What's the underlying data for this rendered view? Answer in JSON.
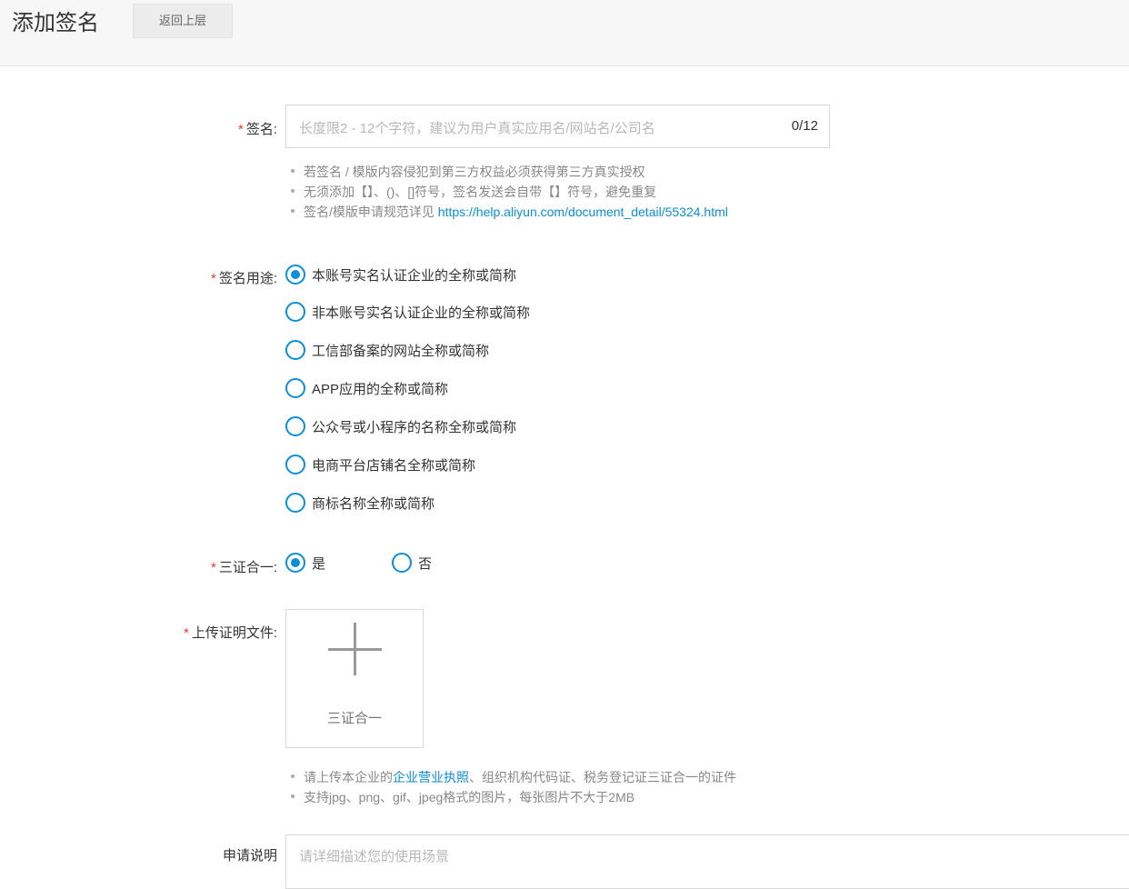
{
  "header": {
    "title": "添加签名",
    "back_label": "返回上层"
  },
  "form": {
    "signature": {
      "required_mark": "*",
      "label": "签名:",
      "placeholder": "长度限2 - 12个字符，建议为用户真实应用名/网站名/公司名",
      "value": "",
      "counter": "0/12",
      "hints": [
        {
          "text": "若签名 / 模版内容侵犯到第三方权益必须获得第三方真实授权"
        },
        {
          "text": "无须添加【】、()、[]符号，签名发送会自带【】符号，避免重复"
        },
        {
          "prefix": "签名/模版申请规范详见 ",
          "link": "https://help.aliyun.com/document_detail/55324.html"
        }
      ]
    },
    "purpose": {
      "required_mark": "*",
      "label": "签名用途:",
      "options": [
        {
          "label": "本账号实名认证企业的全称或简称",
          "checked": true
        },
        {
          "label": "非本账号实名认证企业的全称或简称",
          "checked": false
        },
        {
          "label": "工信部备案的网站全称或简称",
          "checked": false
        },
        {
          "label": "APP应用的全称或简称",
          "checked": false
        },
        {
          "label": "公众号或小程序的名称全称或简称",
          "checked": false
        },
        {
          "label": "电商平台店铺名全称或简称",
          "checked": false
        },
        {
          "label": "商标名称全称或简称",
          "checked": false
        }
      ]
    },
    "three_in_one": {
      "required_mark": "*",
      "label": "三证合一:",
      "options": [
        {
          "label": "是",
          "checked": true
        },
        {
          "label": "否",
          "checked": false
        }
      ]
    },
    "upload": {
      "required_mark": "*",
      "label": "上传证明文件:",
      "box_label": "三证合一",
      "plus_icon": "plus-icon",
      "hints": {
        "line1_prefix": "请上传本企业的",
        "line1_link": "企业营业执照",
        "line1_suffix": "、组织机构代码证、税务登记证三证合一的证件",
        "line2": "支持jpg、png、gif、jpeg格式的图片，每张图片不大于2MB"
      }
    },
    "description": {
      "label": "申请说明",
      "placeholder": "请详细描述您的使用场景"
    }
  },
  "colors": {
    "accent": "#0a8fd8",
    "required": "#e53935",
    "header_bg": "#f7f7f7"
  }
}
